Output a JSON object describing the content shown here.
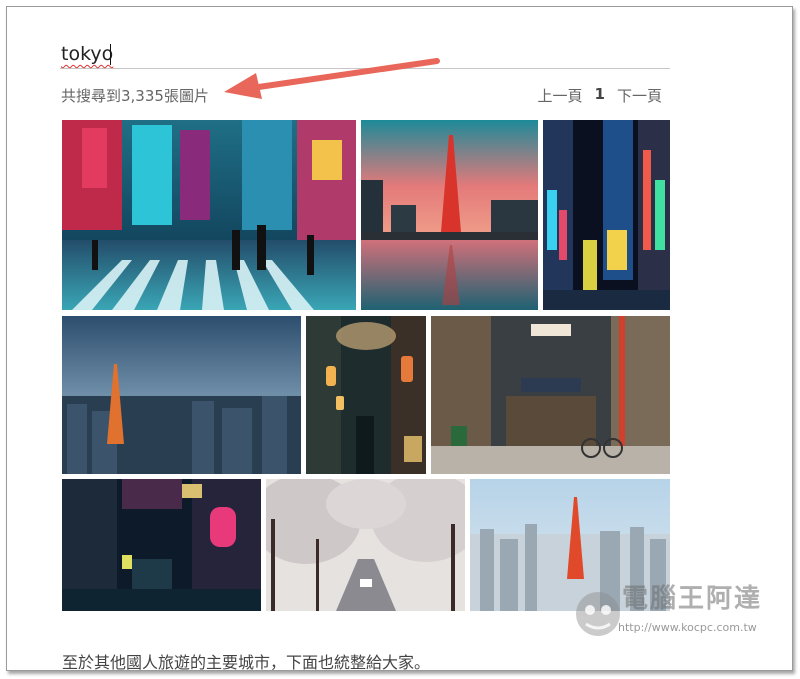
{
  "search": {
    "query": "tokyo"
  },
  "results": {
    "count_text": "共搜尋到3,335張圖片"
  },
  "pagination": {
    "prev_label": "上一頁",
    "current_page": "1",
    "next_label": "下一頁"
  },
  "footer": {
    "caption": "至於其他國人旅遊的主要城市，下面也統整給大家。"
  },
  "watermark": {
    "title": "電腦王阿達",
    "url": "http://www.kocpc.com.tw"
  },
  "colors": {
    "arrow": "#e8675a",
    "text_gray": "#666666"
  }
}
